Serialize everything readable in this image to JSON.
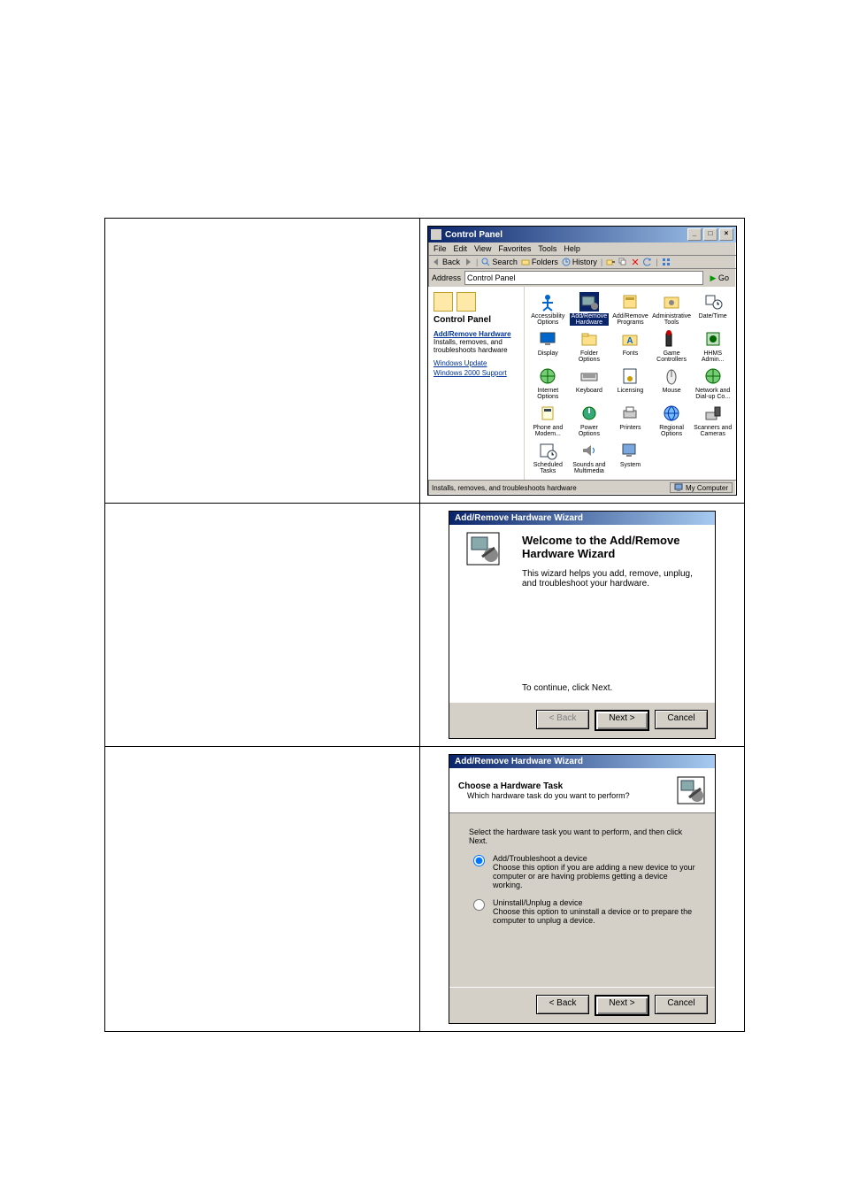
{
  "screenshot1": {
    "window_title": "Control Panel",
    "menu": [
      "File",
      "Edit",
      "View",
      "Favorites",
      "Tools",
      "Help"
    ],
    "toolbar": {
      "back": "Back",
      "search": "Search",
      "folders": "Folders",
      "history": "History"
    },
    "address_label": "Address",
    "address_value": "Control Panel",
    "go_label": "Go",
    "left_panel": {
      "title": "Control Panel",
      "selected_title": "Add/Remove Hardware",
      "selected_desc": "Installs, removes, and troubleshoots hardware",
      "link_update": "Windows Update",
      "link_support": "Windows 2000 Support"
    },
    "icons": [
      {
        "label": "Accessibility Options",
        "selected": false
      },
      {
        "label": "Add/Remove Hardware",
        "selected": true
      },
      {
        "label": "Add/Remove Programs",
        "selected": false
      },
      {
        "label": "Administrative Tools",
        "selected": false
      },
      {
        "label": "Date/Time",
        "selected": false
      },
      {
        "label": "Display",
        "selected": false
      },
      {
        "label": "Folder Options",
        "selected": false
      },
      {
        "label": "Fonts",
        "selected": false
      },
      {
        "label": "Game Controllers",
        "selected": false
      },
      {
        "label": "HHMS Admin...",
        "selected": false
      },
      {
        "label": "Internet Options",
        "selected": false
      },
      {
        "label": "Keyboard",
        "selected": false
      },
      {
        "label": "Licensing",
        "selected": false
      },
      {
        "label": "Mouse",
        "selected": false
      },
      {
        "label": "Network and Dial-up Co...",
        "selected": false
      },
      {
        "label": "Phone and Modem...",
        "selected": false
      },
      {
        "label": "Power Options",
        "selected": false
      },
      {
        "label": "Printers",
        "selected": false
      },
      {
        "label": "Regional Options",
        "selected": false
      },
      {
        "label": "Scanners and Cameras",
        "selected": false
      },
      {
        "label": "Scheduled Tasks",
        "selected": false
      },
      {
        "label": "Sounds and Multimedia",
        "selected": false
      },
      {
        "label": "System",
        "selected": false
      }
    ],
    "status_left": "Installs, removes, and troubleshoots hardware",
    "status_right": "My Computer"
  },
  "screenshot2": {
    "title": "Add/Remove Hardware Wizard",
    "heading": "Welcome to the Add/Remove Hardware Wizard",
    "body": "This wizard helps you add, remove, unplug, and troubleshoot your hardware.",
    "continue": "To continue, click Next.",
    "btn_back": "< Back",
    "btn_next": "Next >",
    "btn_cancel": "Cancel"
  },
  "screenshot3": {
    "title": "Add/Remove Hardware Wizard",
    "header_h1": "Choose a Hardware Task",
    "header_h2": "Which hardware task do you want to perform?",
    "lead": "Select the hardware task you want to perform, and then click Next.",
    "opt1_label": "Add/Troubleshoot a device",
    "opt1_desc": "Choose this option if you are adding a new device to your computer or are having problems getting a device working.",
    "opt2_label": "Uninstall/Unplug a device",
    "opt2_desc": "Choose this option to uninstall a device or to prepare the computer to unplug a device.",
    "btn_back": "< Back",
    "btn_next": "Next >",
    "btn_cancel": "Cancel"
  }
}
